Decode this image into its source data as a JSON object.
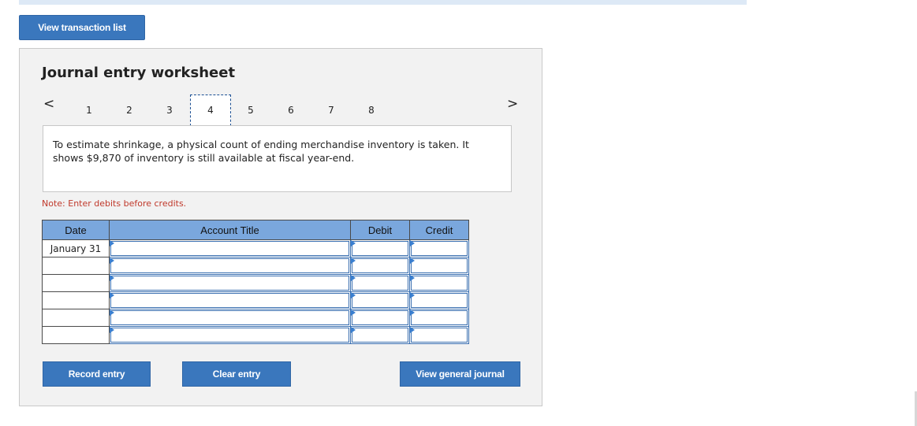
{
  "top_button": {
    "label": "View transaction list"
  },
  "worksheet": {
    "title": "Journal entry worksheet",
    "nav": {
      "prev": "<",
      "next": ">"
    },
    "pages": [
      "1",
      "2",
      "3",
      "4",
      "5",
      "6",
      "7",
      "8"
    ],
    "active_page": "4",
    "description": "To estimate shrinkage, a physical count of ending merchandise inventory is taken. It shows $9,870 of inventory is still available at fiscal year-end.",
    "note": "Note: Enter debits before credits.",
    "table": {
      "headers": {
        "date": "Date",
        "account": "Account Title",
        "debit": "Debit",
        "credit": "Credit"
      },
      "rows": [
        {
          "date": "January 31",
          "account": "",
          "debit": "",
          "credit": ""
        },
        {
          "date": "",
          "account": "",
          "debit": "",
          "credit": ""
        },
        {
          "date": "",
          "account": "",
          "debit": "",
          "credit": ""
        },
        {
          "date": "",
          "account": "",
          "debit": "",
          "credit": ""
        },
        {
          "date": "",
          "account": "",
          "debit": "",
          "credit": ""
        },
        {
          "date": "",
          "account": "",
          "debit": "",
          "credit": ""
        }
      ]
    },
    "buttons": {
      "record": "Record entry",
      "clear": "Clear entry",
      "general": "View general journal"
    }
  },
  "colors": {
    "button": "#3a77bd",
    "table_header": "#7aa7dd",
    "note": "#c0392b",
    "panel": "#f2f2f2"
  }
}
